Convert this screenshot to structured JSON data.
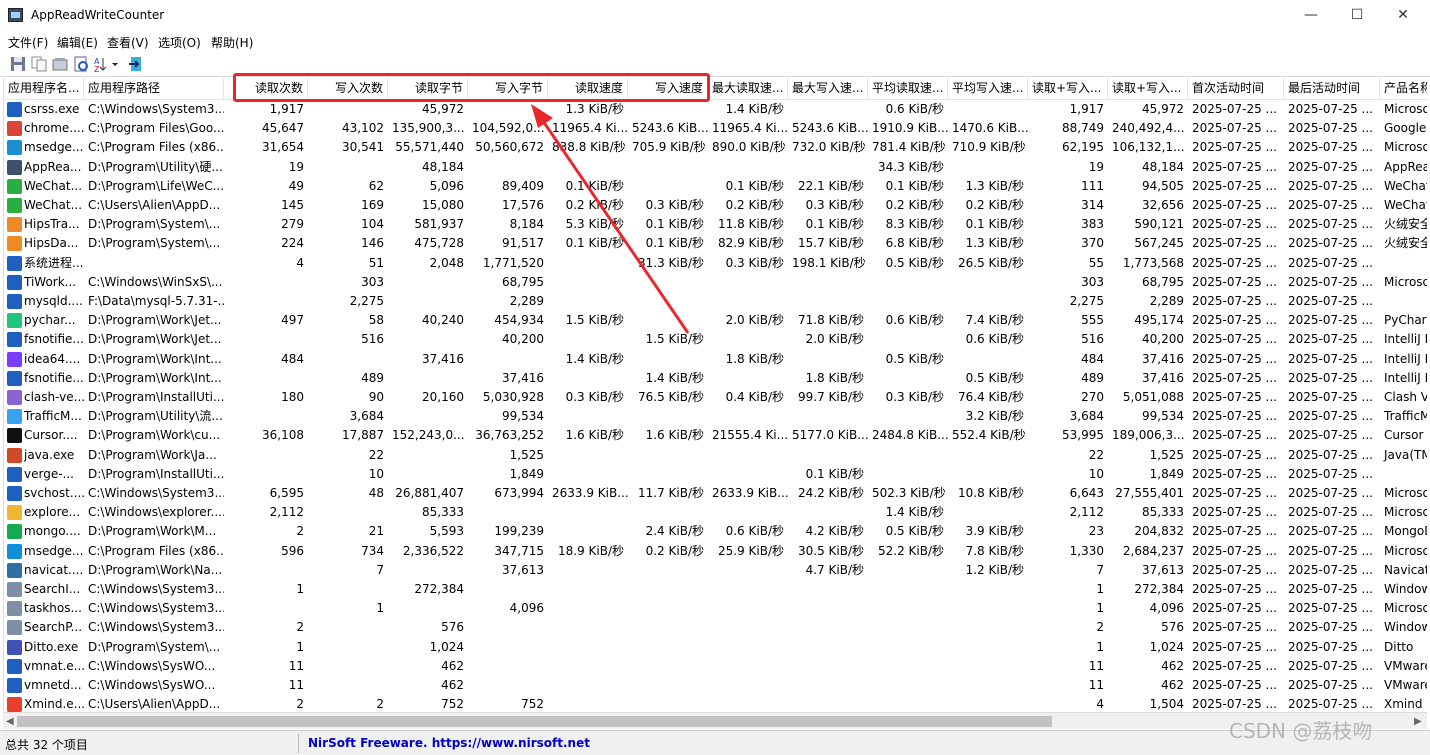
{
  "window": {
    "title": "AppReadWriteCounter",
    "minimize": "—",
    "maximize": "☐",
    "close": "✕"
  },
  "menu": [
    "文件(F)",
    "编辑(E)",
    "查看(V)",
    "选项(O)",
    "帮助(H)"
  ],
  "columns": [
    "应用程序名...",
    "应用程序路径",
    "读取次数",
    "写入次数",
    "读取字节",
    "写入字节",
    "读取速度",
    "写入速度",
    "最大读取速...",
    "最大写入速...",
    "平均读取速...",
    "平均写入速...",
    "读取+写入...",
    "读取+写入...",
    "首次活动时间",
    "最后活动时间",
    "产品名称"
  ],
  "rows": [
    {
      "name": "csrss.exe",
      "path": "C:\\Windows\\System3...",
      "rc": "1,917",
      "wc": "",
      "rb": "45,972",
      "wb": "",
      "rs": "1.3 KiB/秒",
      "ws": "",
      "mrs": "1.4 KiB/秒",
      "mws": "",
      "ars": "0.6 KiB/秒",
      "aws": "",
      "rwc": "1,917",
      "rwb": "45,972",
      "first": "2025-07-25 ...",
      "last": "2025-07-25 ...",
      "product": "Microsoft"
    },
    {
      "name": "chrome....",
      "path": "C:\\Program Files\\Goo...",
      "rc": "45,647",
      "wc": "43,102",
      "rb": "135,900,3...",
      "wb": "104,592,0...",
      "rs": "11965.4 Ki...",
      "ws": "5243.6 KiB...",
      "mrs": "11965.4 Ki...",
      "mws": "5243.6 KiB...",
      "ars": "1910.9 KiB...",
      "aws": "1470.6 KiB...",
      "rwc": "88,749",
      "rwb": "240,492,4...",
      "first": "2025-07-25 ...",
      "last": "2025-07-25 ...",
      "product": "Google C"
    },
    {
      "name": "msedge....",
      "path": "C:\\Program Files (x86...",
      "rc": "31,654",
      "wc": "30,541",
      "rb": "55,571,440",
      "wb": "50,560,672",
      "rs": "838.8 KiB/秒",
      "ws": "705.9 KiB/秒",
      "mrs": "890.0 KiB/秒",
      "mws": "732.0 KiB/秒",
      "ars": "781.4 KiB/秒",
      "aws": "710.9 KiB/秒",
      "rwc": "62,195",
      "rwb": "106,132,1...",
      "first": "2025-07-25 ...",
      "last": "2025-07-25 ...",
      "product": "Microsoft"
    },
    {
      "name": "AppRea...",
      "path": "D:\\Program\\Utility\\硬...",
      "rc": "19",
      "wc": "",
      "rb": "48,184",
      "wb": "",
      "rs": "",
      "ws": "",
      "mrs": "",
      "mws": "",
      "ars": "34.3 KiB/秒",
      "aws": "",
      "rwc": "19",
      "rwb": "48,184",
      "first": "2025-07-25 ...",
      "last": "2025-07-25 ...",
      "product": "AppRead"
    },
    {
      "name": "WeChat...",
      "path": "D:\\Program\\Life\\WeC...",
      "rc": "49",
      "wc": "62",
      "rb": "5,096",
      "wb": "89,409",
      "rs": "0.1 KiB/秒",
      "ws": "",
      "mrs": "0.1 KiB/秒",
      "mws": "22.1 KiB/秒",
      "ars": "0.1 KiB/秒",
      "aws": "1.3 KiB/秒",
      "rwc": "111",
      "rwb": "94,505",
      "first": "2025-07-25 ...",
      "last": "2025-07-25 ...",
      "product": "WeChat"
    },
    {
      "name": "WeChat...",
      "path": "C:\\Users\\Alien\\AppD...",
      "rc": "145",
      "wc": "169",
      "rb": "15,080",
      "wb": "17,576",
      "rs": "0.2 KiB/秒",
      "ws": "0.3 KiB/秒",
      "mrs": "0.2 KiB/秒",
      "mws": "0.3 KiB/秒",
      "ars": "0.2 KiB/秒",
      "aws": "0.2 KiB/秒",
      "rwc": "314",
      "rwb": "32,656",
      "first": "2025-07-25 ...",
      "last": "2025-07-25 ...",
      "product": "WeChat"
    },
    {
      "name": "HipsTra...",
      "path": "D:\\Program\\System\\...",
      "rc": "279",
      "wc": "104",
      "rb": "581,937",
      "wb": "8,184",
      "rs": "5.3 KiB/秒",
      "ws": "0.1 KiB/秒",
      "mrs": "11.8 KiB/秒",
      "mws": "0.1 KiB/秒",
      "ars": "8.3 KiB/秒",
      "aws": "0.1 KiB/秒",
      "rwc": "383",
      "rwb": "590,121",
      "first": "2025-07-25 ...",
      "last": "2025-07-25 ...",
      "product": "火绒安全"
    },
    {
      "name": "HipsDa...",
      "path": "D:\\Program\\System\\...",
      "rc": "224",
      "wc": "146",
      "rb": "475,728",
      "wb": "91,517",
      "rs": "0.1 KiB/秒",
      "ws": "0.1 KiB/秒",
      "mrs": "82.9 KiB/秒",
      "mws": "15.7 KiB/秒",
      "ars": "6.8 KiB/秒",
      "aws": "1.3 KiB/秒",
      "rwc": "370",
      "rwb": "567,245",
      "first": "2025-07-25 ...",
      "last": "2025-07-25 ...",
      "product": "火绒安全"
    },
    {
      "name": "系统进程...",
      "path": "",
      "rc": "4",
      "wc": "51",
      "rb": "2,048",
      "wb": "1,771,520",
      "rs": "",
      "ws": "31.3 KiB/秒",
      "mrs": "0.3 KiB/秒",
      "mws": "198.1 KiB/秒",
      "ars": "0.5 KiB/秒",
      "aws": "26.5 KiB/秒",
      "rwc": "55",
      "rwb": "1,773,568",
      "first": "2025-07-25 ...",
      "last": "2025-07-25 ...",
      "product": ""
    },
    {
      "name": "TiWork...",
      "path": "C:\\Windows\\WinSxS\\...",
      "rc": "",
      "wc": "303",
      "rb": "",
      "wb": "68,795",
      "rs": "",
      "ws": "",
      "mrs": "",
      "mws": "",
      "ars": "",
      "aws": "",
      "rwc": "303",
      "rwb": "68,795",
      "first": "2025-07-25 ...",
      "last": "2025-07-25 ...",
      "product": "Microsoft"
    },
    {
      "name": "mysqld....",
      "path": "F:\\Data\\mysql-5.7.31-...",
      "rc": "",
      "wc": "2,275",
      "rb": "",
      "wb": "2,289",
      "rs": "",
      "ws": "",
      "mrs": "",
      "mws": "",
      "ars": "",
      "aws": "",
      "rwc": "2,275",
      "rwb": "2,289",
      "first": "2025-07-25 ...",
      "last": "2025-07-25 ...",
      "product": ""
    },
    {
      "name": "pychar...",
      "path": "D:\\Program\\Work\\Jet...",
      "rc": "497",
      "wc": "58",
      "rb": "40,240",
      "wb": "454,934",
      "rs": "1.5 KiB/秒",
      "ws": "",
      "mrs": "2.0 KiB/秒",
      "mws": "71.8 KiB/秒",
      "ars": "0.6 KiB/秒",
      "aws": "7.4 KiB/秒",
      "rwc": "555",
      "rwb": "495,174",
      "first": "2025-07-25 ...",
      "last": "2025-07-25 ...",
      "product": "PyCharm"
    },
    {
      "name": "fsnotifie...",
      "path": "D:\\Program\\Work\\Jet...",
      "rc": "",
      "wc": "516",
      "rb": "",
      "wb": "40,200",
      "rs": "",
      "ws": "1.5 KiB/秒",
      "mrs": "",
      "mws": "2.0 KiB/秒",
      "ars": "",
      "aws": "0.6 KiB/秒",
      "rwc": "516",
      "rwb": "40,200",
      "first": "2025-07-25 ...",
      "last": "2025-07-25 ...",
      "product": "IntelliJ P"
    },
    {
      "name": "idea64....",
      "path": "D:\\Program\\Work\\Int...",
      "rc": "484",
      "wc": "",
      "rb": "37,416",
      "wb": "",
      "rs": "1.4 KiB/秒",
      "ws": "",
      "mrs": "1.8 KiB/秒",
      "mws": "",
      "ars": "0.5 KiB/秒",
      "aws": "",
      "rwc": "484",
      "rwb": "37,416",
      "first": "2025-07-25 ...",
      "last": "2025-07-25 ...",
      "product": "IntelliJ ID"
    },
    {
      "name": "fsnotifie...",
      "path": "D:\\Program\\Work\\Int...",
      "rc": "",
      "wc": "489",
      "rb": "",
      "wb": "37,416",
      "rs": "",
      "ws": "1.4 KiB/秒",
      "mrs": "",
      "mws": "1.8 KiB/秒",
      "ars": "",
      "aws": "0.5 KiB/秒",
      "rwc": "489",
      "rwb": "37,416",
      "first": "2025-07-25 ...",
      "last": "2025-07-25 ...",
      "product": "IntelliJ P"
    },
    {
      "name": "clash-ve...",
      "path": "D:\\Program\\InstallUti...",
      "rc": "180",
      "wc": "90",
      "rb": "20,160",
      "wb": "5,030,928",
      "rs": "0.3 KiB/秒",
      "ws": "76.5 KiB/秒",
      "mrs": "0.4 KiB/秒",
      "mws": "99.7 KiB/秒",
      "ars": "0.3 KiB/秒",
      "aws": "76.4 KiB/秒",
      "rwc": "270",
      "rwb": "5,051,088",
      "first": "2025-07-25 ...",
      "last": "2025-07-25 ...",
      "product": "Clash Ve"
    },
    {
      "name": "TrafficM...",
      "path": "D:\\Program\\Utility\\流...",
      "rc": "",
      "wc": "3,684",
      "rb": "",
      "wb": "99,534",
      "rs": "",
      "ws": "",
      "mrs": "",
      "mws": "",
      "ars": "",
      "aws": "3.2 KiB/秒",
      "rwc": "3,684",
      "rwb": "99,534",
      "first": "2025-07-25 ...",
      "last": "2025-07-25 ...",
      "product": "TrafficM"
    },
    {
      "name": "Cursor....",
      "path": "D:\\Program\\Work\\cu...",
      "rc": "36,108",
      "wc": "17,887",
      "rb": "152,243,0...",
      "wb": "36,763,252",
      "rs": "1.6 KiB/秒",
      "ws": "1.6 KiB/秒",
      "mrs": "21555.4 Ki...",
      "mws": "5177.0 KiB...",
      "ars": "2484.8 KiB...",
      "aws": "552.4 KiB/秒",
      "rwc": "53,995",
      "rwb": "189,006,3...",
      "first": "2025-07-25 ...",
      "last": "2025-07-25 ...",
      "product": "Cursor"
    },
    {
      "name": "java.exe",
      "path": "D:\\Program\\Work\\Ja...",
      "rc": "",
      "wc": "22",
      "rb": "",
      "wb": "1,525",
      "rs": "",
      "ws": "",
      "mrs": "",
      "mws": "",
      "ars": "",
      "aws": "",
      "rwc": "22",
      "rwb": "1,525",
      "first": "2025-07-25 ...",
      "last": "2025-07-25 ...",
      "product": "Java(TM)"
    },
    {
      "name": "verge-...",
      "path": "D:\\Program\\InstallUti...",
      "rc": "",
      "wc": "10",
      "rb": "",
      "wb": "1,849",
      "rs": "",
      "ws": "",
      "mrs": "",
      "mws": "0.1 KiB/秒",
      "ars": "",
      "aws": "",
      "rwc": "10",
      "rwb": "1,849",
      "first": "2025-07-25 ...",
      "last": "2025-07-25 ...",
      "product": ""
    },
    {
      "name": "svchost....",
      "path": "C:\\Windows\\System3...",
      "rc": "6,595",
      "wc": "48",
      "rb": "26,881,407",
      "wb": "673,994",
      "rs": "2633.9 KiB...",
      "ws": "11.7 KiB/秒",
      "mrs": "2633.9 KiB...",
      "mws": "24.2 KiB/秒",
      "ars": "502.3 KiB/秒",
      "aws": "10.8 KiB/秒",
      "rwc": "6,643",
      "rwb": "27,555,401",
      "first": "2025-07-25 ...",
      "last": "2025-07-25 ...",
      "product": "Microsoft"
    },
    {
      "name": "explore...",
      "path": "C:\\Windows\\explorer....",
      "rc": "2,112",
      "wc": "",
      "rb": "85,333",
      "wb": "",
      "rs": "",
      "ws": "",
      "mrs": "",
      "mws": "",
      "ars": "1.4 KiB/秒",
      "aws": "",
      "rwc": "2,112",
      "rwb": "85,333",
      "first": "2025-07-25 ...",
      "last": "2025-07-25 ...",
      "product": "Microsoft"
    },
    {
      "name": "mongo....",
      "path": "D:\\Program\\Work\\M...",
      "rc": "2",
      "wc": "21",
      "rb": "5,593",
      "wb": "199,239",
      "rs": "",
      "ws": "2.4 KiB/秒",
      "mrs": "0.6 KiB/秒",
      "mws": "4.2 KiB/秒",
      "ars": "0.5 KiB/秒",
      "aws": "3.9 KiB/秒",
      "rwc": "23",
      "rwb": "204,832",
      "first": "2025-07-25 ...",
      "last": "2025-07-25 ...",
      "product": "MongoDB"
    },
    {
      "name": "msedge....",
      "path": "C:\\Program Files (x86...",
      "rc": "596",
      "wc": "734",
      "rb": "2,336,522",
      "wb": "347,715",
      "rs": "18.9 KiB/秒",
      "ws": "0.2 KiB/秒",
      "mrs": "25.9 KiB/秒",
      "mws": "30.5 KiB/秒",
      "ars": "52.2 KiB/秒",
      "aws": "7.8 KiB/秒",
      "rwc": "1,330",
      "rwb": "2,684,237",
      "first": "2025-07-25 ...",
      "last": "2025-07-25 ...",
      "product": "Microsoft"
    },
    {
      "name": "navicat....",
      "path": "D:\\Program\\Work\\Na...",
      "rc": "",
      "wc": "7",
      "rb": "",
      "wb": "37,613",
      "rs": "",
      "ws": "",
      "mrs": "",
      "mws": "4.7 KiB/秒",
      "ars": "",
      "aws": "1.2 KiB/秒",
      "rwc": "7",
      "rwb": "37,613",
      "first": "2025-07-25 ...",
      "last": "2025-07-25 ...",
      "product": "Navicat"
    },
    {
      "name": "SearchI...",
      "path": "C:\\Windows\\System3...",
      "rc": "1",
      "wc": "",
      "rb": "272,384",
      "wb": "",
      "rs": "",
      "ws": "",
      "mrs": "",
      "mws": "",
      "ars": "",
      "aws": "",
      "rwc": "1",
      "rwb": "272,384",
      "first": "2025-07-25 ...",
      "last": "2025-07-25 ...",
      "product": "Windows"
    },
    {
      "name": "taskhos...",
      "path": "C:\\Windows\\System3...",
      "rc": "",
      "wc": "1",
      "rb": "",
      "wb": "4,096",
      "rs": "",
      "ws": "",
      "mrs": "",
      "mws": "",
      "ars": "",
      "aws": "",
      "rwc": "1",
      "rwb": "4,096",
      "first": "2025-07-25 ...",
      "last": "2025-07-25 ...",
      "product": "Microsoft"
    },
    {
      "name": "SearchP...",
      "path": "C:\\Windows\\System3...",
      "rc": "2",
      "wc": "",
      "rb": "576",
      "wb": "",
      "rs": "",
      "ws": "",
      "mrs": "",
      "mws": "",
      "ars": "",
      "aws": "",
      "rwc": "2",
      "rwb": "576",
      "first": "2025-07-25 ...",
      "last": "2025-07-25 ...",
      "product": "Windows"
    },
    {
      "name": "Ditto.exe",
      "path": "D:\\Program\\System\\...",
      "rc": "1",
      "wc": "",
      "rb": "1,024",
      "wb": "",
      "rs": "",
      "ws": "",
      "mrs": "",
      "mws": "",
      "ars": "",
      "aws": "",
      "rwc": "1",
      "rwb": "1,024",
      "first": "2025-07-25 ...",
      "last": "2025-07-25 ...",
      "product": "Ditto"
    },
    {
      "name": "vmnat.e...",
      "path": "C:\\Windows\\SysWO...",
      "rc": "11",
      "wc": "",
      "rb": "462",
      "wb": "",
      "rs": "",
      "ws": "",
      "mrs": "",
      "mws": "",
      "ars": "",
      "aws": "",
      "rwc": "11",
      "rwb": "462",
      "first": "2025-07-25 ...",
      "last": "2025-07-25 ...",
      "product": "VMware"
    },
    {
      "name": "vmnetd...",
      "path": "C:\\Windows\\SysWO...",
      "rc": "11",
      "wc": "",
      "rb": "462",
      "wb": "",
      "rs": "",
      "ws": "",
      "mrs": "",
      "mws": "",
      "ars": "",
      "aws": "",
      "rwc": "11",
      "rwb": "462",
      "first": "2025-07-25 ...",
      "last": "2025-07-25 ...",
      "product": "VMware"
    },
    {
      "name": "Xmind.e...",
      "path": "C:\\Users\\Alien\\AppD...",
      "rc": "2",
      "wc": "2",
      "rb": "752",
      "wb": "752",
      "rs": "",
      "ws": "",
      "mrs": "",
      "mws": "",
      "ars": "",
      "aws": "",
      "rwc": "4",
      "rwb": "1,504",
      "first": "2025-07-25 ...",
      "last": "2025-07-25 ...",
      "product": "Xmind"
    }
  ],
  "row_icons": [
    "#1f5fbf",
    "#db4437",
    "#1b8fd1",
    "#3c4f6b",
    "#2aae3f",
    "#2aae3f",
    "#f08a24",
    "#f08a24",
    "#1f5fbf",
    "#1f5fbf",
    "#1f5fbf",
    "#21c47b",
    "#1f5fbf",
    "#7a3cff",
    "#1f5fbf",
    "#8a63d2",
    "#3aa0f0",
    "#111111",
    "#d04a2a",
    "#1f5fbf",
    "#1f5fbf",
    "#f2b530",
    "#13aa52",
    "#0e8fd8",
    "#2f6fa3",
    "#7f8fa6",
    "#7f8fa6",
    "#7f8fa6",
    "#3f51b5",
    "#1f5fbf",
    "#1f5fbf",
    "#e8402a"
  ],
  "status": {
    "count": "总共 32 个项目",
    "link": "NirSoft Freeware. https://www.nirsoft.net"
  },
  "watermark": "CSDN @荔枝吻",
  "scroll": {
    "left": "◀",
    "right": "▶"
  },
  "annotation_color": "#e8282c"
}
